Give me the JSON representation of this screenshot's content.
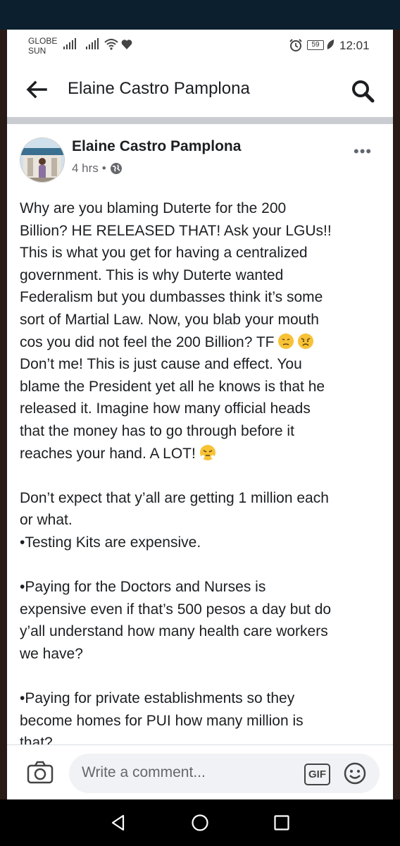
{
  "status_bar": {
    "carrier_line1": "GLOBE",
    "carrier_line2": "SUN",
    "battery": "59",
    "time": "12:01"
  },
  "header": {
    "title": "Elaine Castro Pamplona",
    "back_icon": "arrow-left-icon",
    "search_icon": "search-icon"
  },
  "post": {
    "author": "Elaine Castro Pamplona",
    "time": "4 hrs",
    "separator": "•",
    "more_label": "•••",
    "lines": [
      "Why are you blaming Duterte for the 200",
      "Billion? HE RELEASED THAT! Ask your LGUs!!",
      "This is what you get for having a centralized",
      "government. This is why Duterte wanted",
      "Federalism but you dumbasses think it’s some",
      "sort of Martial Law. Now, you blab your mouth",
      "cos you did not feel the 200 Billion? TF",
      "Don’t me! This is just cause and effect. You",
      "blame the President yet all he knows is that he",
      "released it. Imagine how many official heads",
      "that the money has to go through before it",
      "reaches your hand. A LOT!",
      "",
      "Don’t expect that y’all are getting 1 million each",
      "or what.",
      "•Testing Kits are expensive.",
      "",
      "•Paying for the Doctors and Nurses is",
      "expensive even if that’s 500 pesos a day but do",
      "y’all understand how many health care workers",
      "we have?",
      "",
      "•Paying for private establishments so they",
      "become homes for PUI how many million is",
      "that?"
    ]
  },
  "comment_bar": {
    "placeholder": "Write a comment...",
    "gif_label": "GIF"
  },
  "colors": {
    "text": "#1c1e21",
    "secondary": "#65676b",
    "divider": "#c9ccd1",
    "input_bg": "#f0f2f5"
  }
}
